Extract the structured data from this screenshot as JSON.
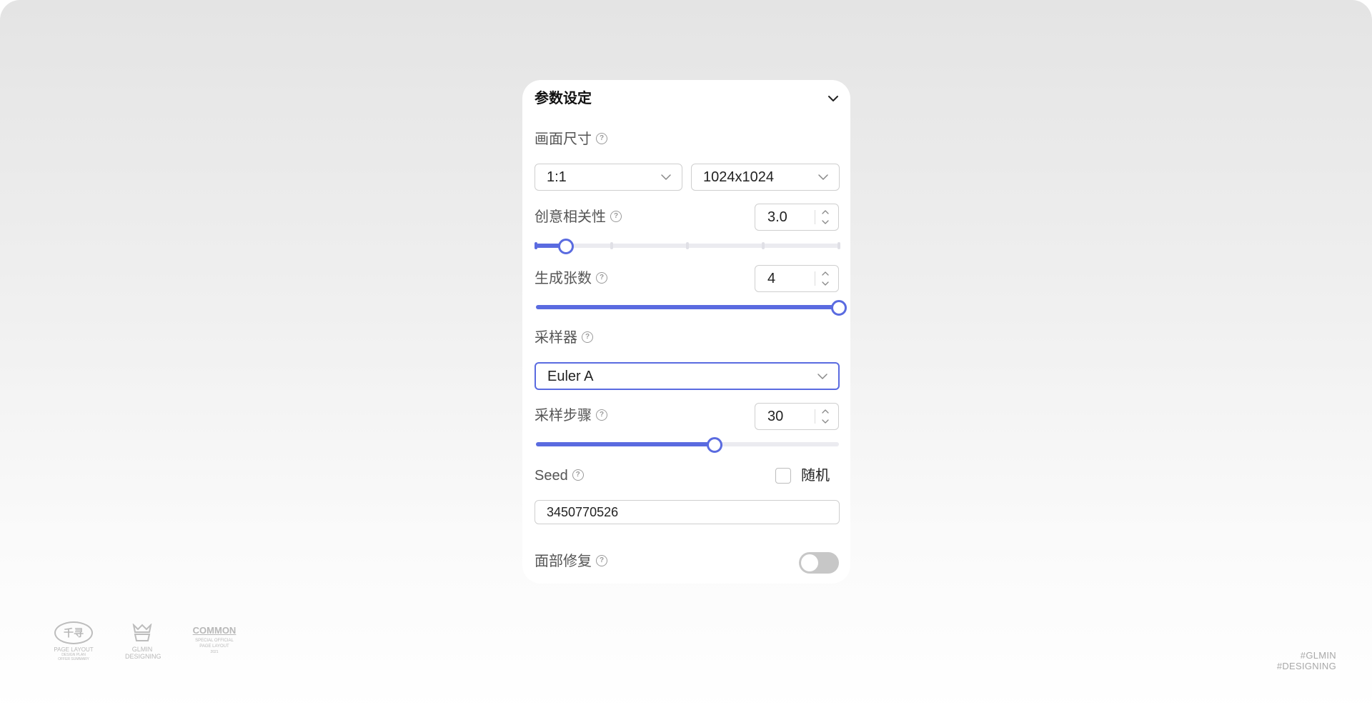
{
  "panel": {
    "title": "参数设定",
    "collapse_icon": "chevron-down-icon"
  },
  "canvas_size": {
    "label": "画面尺寸",
    "ratio_value": "1:1",
    "resolution_value": "1024x1024"
  },
  "creativity": {
    "label": "创意相关性",
    "value": "3.0",
    "slider_fraction": 0.1
  },
  "image_count": {
    "label": "生成张数",
    "value": "4",
    "slider_fraction": 1.0
  },
  "sampler": {
    "label": "采样器",
    "value": "Euler A"
  },
  "sampling_steps": {
    "label": "采样步骤",
    "value": "30",
    "slider_fraction": 0.59
  },
  "seed": {
    "label": "Seed",
    "random_label": "随机",
    "random_checked": false,
    "value": "3450770526"
  },
  "face_restore": {
    "label": "面部修复",
    "enabled": false
  },
  "help_icon_glyph": "?",
  "colors": {
    "accent": "#5a6be0",
    "track": "#ebebf0",
    "border": "#cfcfcf"
  },
  "footer": {
    "logos": [
      {
        "main": "千寻",
        "lines": [
          "PAGE LAYOUT",
          "DESIGN PLAN",
          "OFFER SUMMARY"
        ]
      },
      {
        "main": "GLMIN",
        "lines": [
          "GLMIN",
          "DESIGNING"
        ]
      },
      {
        "main": "COMMON",
        "lines": [
          "SPECIAL OFFICIAL",
          "PAGE LAYOUT",
          "2021"
        ]
      }
    ],
    "watermark_line1": "#GLMIN",
    "watermark_line2": "#DESIGNING"
  }
}
